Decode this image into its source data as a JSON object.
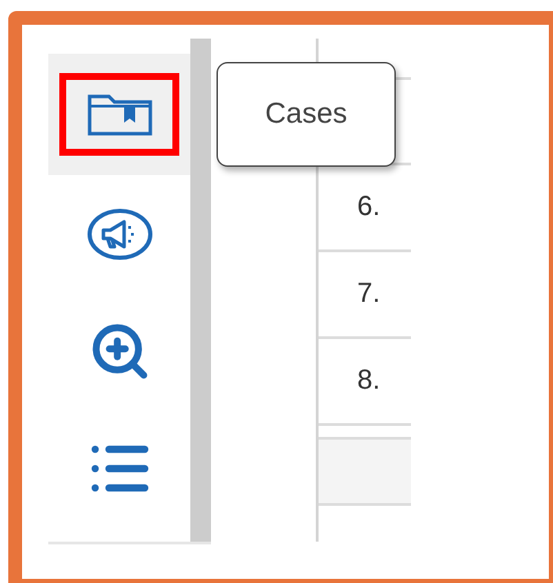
{
  "sidebar": {
    "items": [
      {
        "kind": "cases",
        "selected": true,
        "highlighted": true
      },
      {
        "kind": "announcements",
        "selected": false,
        "highlighted": false
      },
      {
        "kind": "zoom",
        "selected": false,
        "highlighted": false
      },
      {
        "kind": "list",
        "selected": false,
        "highlighted": false
      }
    ]
  },
  "tooltip": {
    "text": "Cases"
  },
  "table": {
    "rows": [
      {
        "number": "6."
      },
      {
        "number": "7."
      },
      {
        "number": "8."
      }
    ]
  }
}
